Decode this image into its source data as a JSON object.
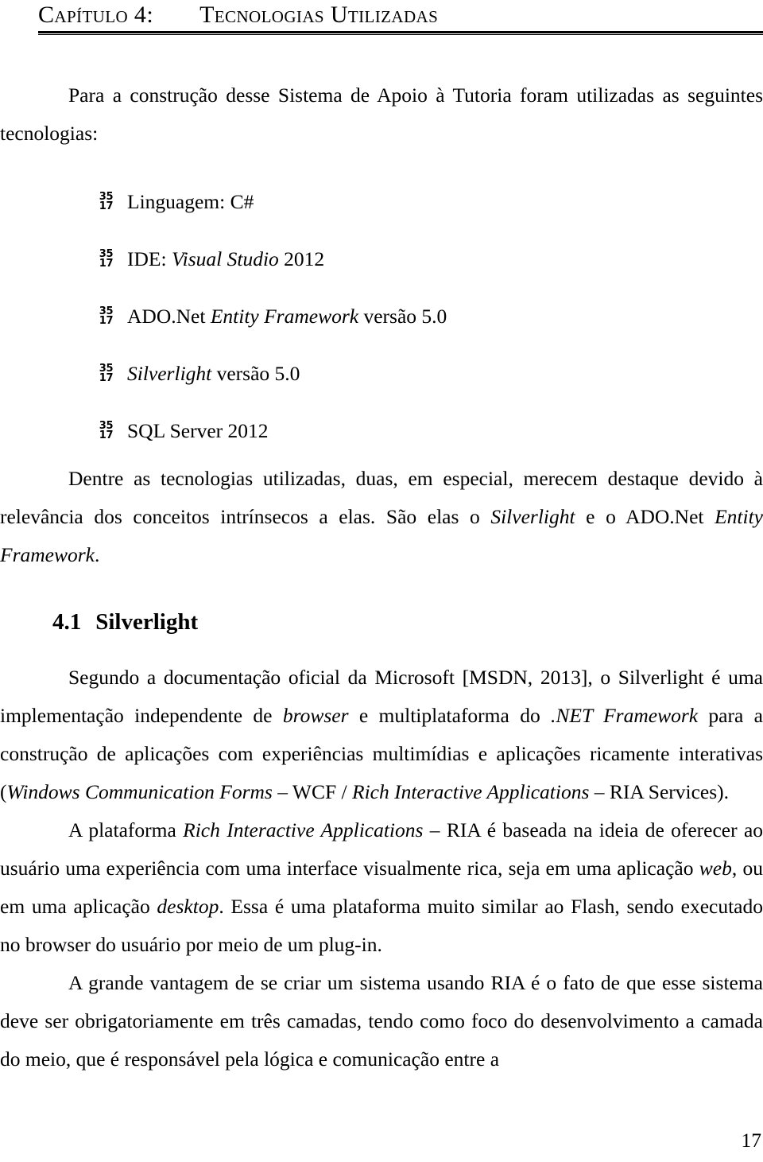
{
  "header": {
    "chapter_label": "Capítulo 4:",
    "chapter_title": "Tecnologias Utilizadas"
  },
  "intro": {
    "text": "Para a construção desse Sistema de Apoio à Tutoria foram utilizadas as seguintes tecnologias:"
  },
  "bullet_marker": {
    "top": "35",
    "bottom": "17"
  },
  "tech_list": [
    {
      "plain_before": "Linguagem: C#",
      "italic": "",
      "plain_after": ""
    },
    {
      "plain_before": "IDE: ",
      "italic": "Visual Studio",
      "plain_after": " 2012"
    },
    {
      "plain_before": "ADO.Net ",
      "italic": "Entity Framework",
      "plain_after": " versão 5.0"
    },
    {
      "plain_before": "",
      "italic": "Silverlight",
      "plain_after": " versão 5.0"
    },
    {
      "plain_before": "SQL Server 2012",
      "italic": "",
      "plain_after": ""
    }
  ],
  "highlight_para": {
    "part1": "Dentre as tecnologias utilizadas, duas, em especial, merecem destaque devido à relevância dos conceitos intrínsecos a elas. São elas o ",
    "italic1": "Silverlight",
    "part2": " e o ADO.Net ",
    "italic2": "Entity Framework",
    "part3": "."
  },
  "section": {
    "number": "4.1",
    "title": "Silverlight"
  },
  "paragraphs": {
    "p1": {
      "part1": "Segundo a documentação oficial da Microsoft [MSDN, 2013], o Silverlight é uma implementação independente de ",
      "italic1": "browser",
      "part2": " e multiplataforma do ",
      "italic2": ".NET Framework",
      "part3": " para a construção de aplicações com experiências multimídias e aplicações ricamente interativas (",
      "italic3": "Windows Communication Forms",
      "part4": " – WCF / ",
      "italic4": "Rich Interactive Applications",
      "part5": " – RIA Services)."
    },
    "p2": {
      "part1": "A plataforma ",
      "italic1": "Rich Interactive Applications",
      "part2": " – RIA é baseada na ideia de oferecer ao usuário uma experiência com uma interface visualmente rica, seja em uma aplicação ",
      "italic2": "web",
      "part3": ", ou em uma aplicação ",
      "italic3": "desktop",
      "part4": ". Essa é uma plataforma muito similar ao Flash, sendo executado no browser do usuário por meio de um plug-in."
    },
    "p3": {
      "text": "A grande vantagem de se criar um sistema usando RIA é o fato de que esse sistema deve ser obrigatoriamente em três camadas, tendo como foco do desenvolvimento a camada do meio, que é responsável pela lógica e comunicação entre a"
    }
  },
  "footer": {
    "page_number": "17"
  }
}
